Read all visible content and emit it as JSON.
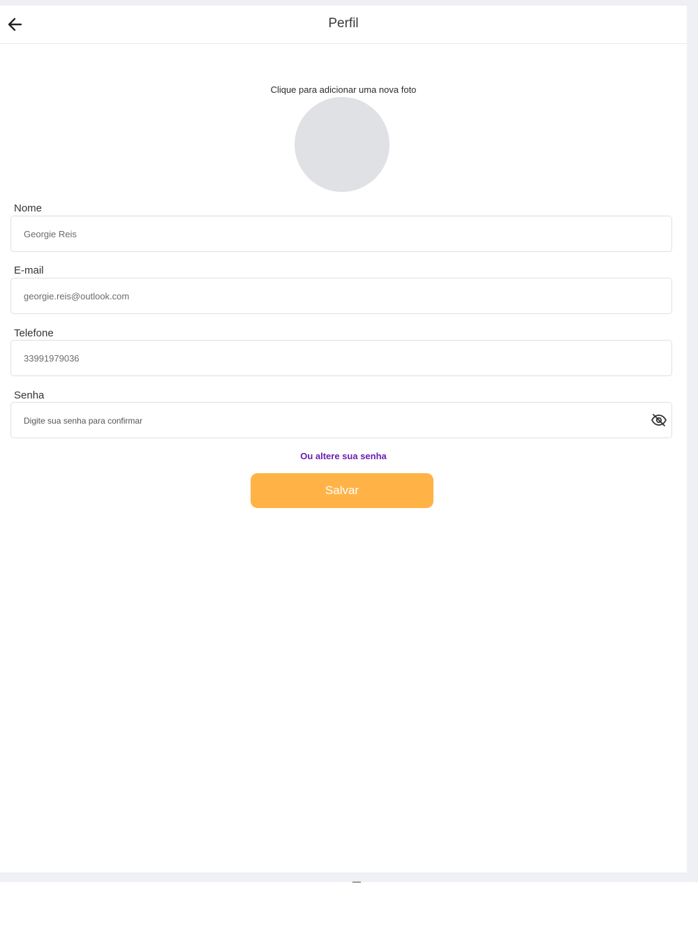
{
  "header": {
    "title": "Perfil",
    "back_icon": "arrow-left-icon"
  },
  "photo": {
    "hint": "Clique para adicionar uma nova foto",
    "avatar_color": "#dfe1e5"
  },
  "form": {
    "name": {
      "label": "Nome",
      "value": "Georgie Reis"
    },
    "email": {
      "label": "E-mail",
      "value": "georgie.reis@outlook.com"
    },
    "phone": {
      "label": "Telefone",
      "value": "33991979036"
    },
    "password": {
      "label": "Senha",
      "value": "",
      "placeholder": "Digite sua senha para confirmar",
      "toggle_icon": "eye-off-icon"
    }
  },
  "links": {
    "change_password": "Ou altere sua  senha"
  },
  "actions": {
    "save_label": "Salvar"
  },
  "colors": {
    "accent": "#ffb347",
    "link": "#6a1fb0"
  }
}
